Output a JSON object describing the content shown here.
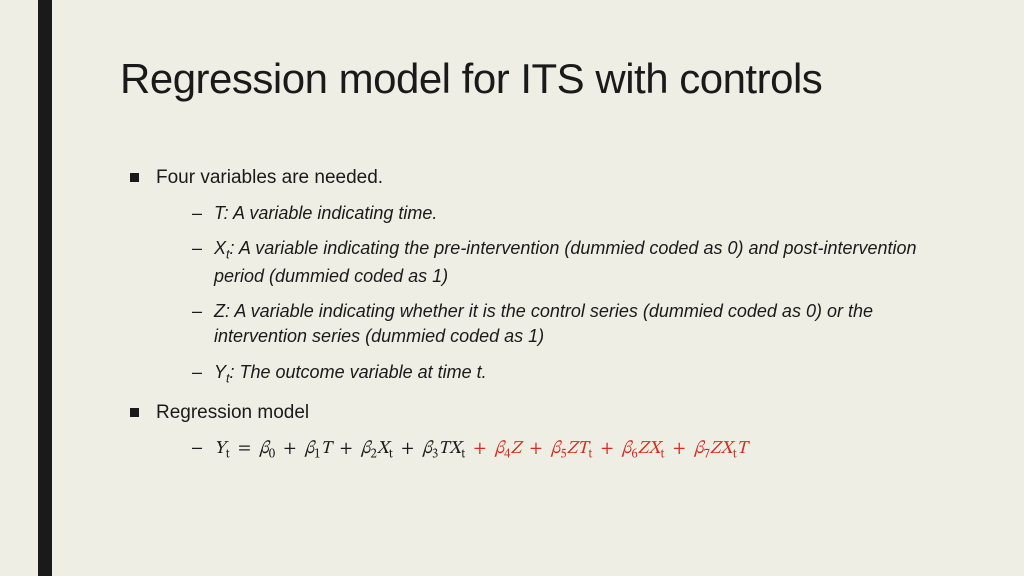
{
  "title": "Regression model for ITS with controls",
  "bullets": {
    "b1": {
      "label": "Four variables are needed.",
      "items": {
        "i1_pre": "T: A variable indicating time.",
        "i2_var": "X",
        "i2_sub": "t",
        "i2_rest": ": A variable indicating the pre-intervention (dummied coded as 0) and post-intervention period (dummied coded as 1)",
        "i3": "Z: A variable indicating whether it is the control series (dummied coded as 0) or the intervention series (dummied coded as 1)",
        "i4_var": "Y",
        "i4_sub": "t",
        "i4_rest": ": The outcome variable at time t."
      }
    },
    "b2": {
      "label": "Regression model",
      "equation": {
        "lhs_Y": "Y",
        "lhs_t": "t",
        "eq": "=",
        "b0": "β",
        "s0": "0",
        "p1": "+",
        "b1": "β",
        "s1": "1",
        "v1": "T",
        "p2": "+",
        "b2": "β",
        "s2": "2",
        "v2": "X",
        "v2s": "t",
        "p3": "+",
        "b3": "β",
        "s3": "3",
        "v3a": "T",
        "v3b": "X",
        "v3s": "t",
        "rp4": "+",
        "rb4": "β",
        "rs4": "4",
        "rv4": "Z",
        "rp5": "+",
        "rb5": "β",
        "rs5": "5",
        "rv5a": "Z",
        "rv5b": "T",
        "rv5s": "t",
        "rp6": "+",
        "rb6": "β",
        "rs6": "6",
        "rv6a": "Z",
        "rv6b": "X",
        "rv6s": "t",
        "rp7": "+",
        "rb7": "β",
        "rs7": "7",
        "rv7a": "Z",
        "rv7b": "X",
        "rv7s": "t",
        "rv7c": "T"
      }
    }
  }
}
